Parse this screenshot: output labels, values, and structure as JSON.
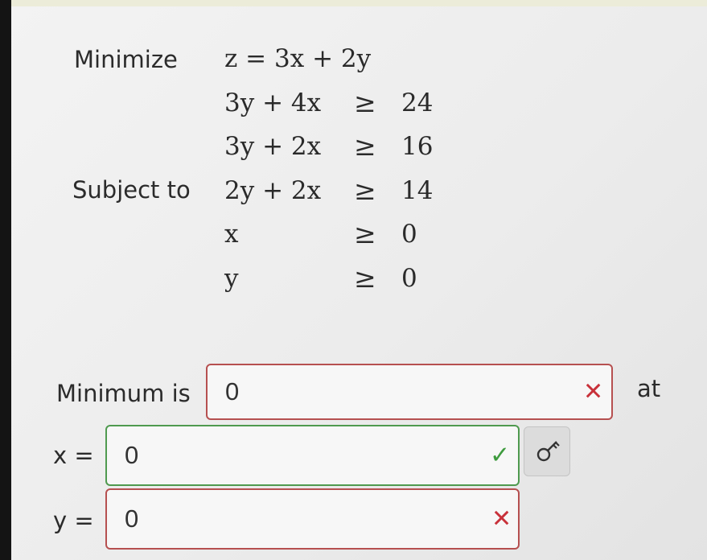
{
  "problem": {
    "minimize_label": "Minimize",
    "objective": "z = 3x + 2y",
    "subject_to_label": "Subject to",
    "constraints": [
      {
        "lhs": "3y + 4x",
        "rel": "≥",
        "rhs": "24"
      },
      {
        "lhs": "3y + 2x",
        "rel": "≥",
        "rhs": "16"
      },
      {
        "lhs": "2y + 2x",
        "rel": "≥",
        "rhs": "14"
      },
      {
        "lhs": "x",
        "rel": "≥",
        "rhs": "0"
      },
      {
        "lhs": "y",
        "rel": "≥",
        "rhs": "0"
      }
    ]
  },
  "answers": {
    "minimum_label": "Minimum is",
    "minimum_value": "0",
    "minimum_status": "incorrect",
    "minimum_mark": "✕",
    "at_label": "at",
    "x_label": "x =",
    "x_value": "0",
    "x_status": "correct",
    "x_mark": "✓",
    "y_label": "y =",
    "y_value": "0",
    "y_status": "incorrect",
    "y_mark": "✕",
    "key_icon": "key-icon"
  },
  "colors": {
    "incorrect": "#b65050",
    "correct": "#4f9a4f",
    "x_mark": "#c8313a",
    "check_mark": "#3e9b3e"
  }
}
